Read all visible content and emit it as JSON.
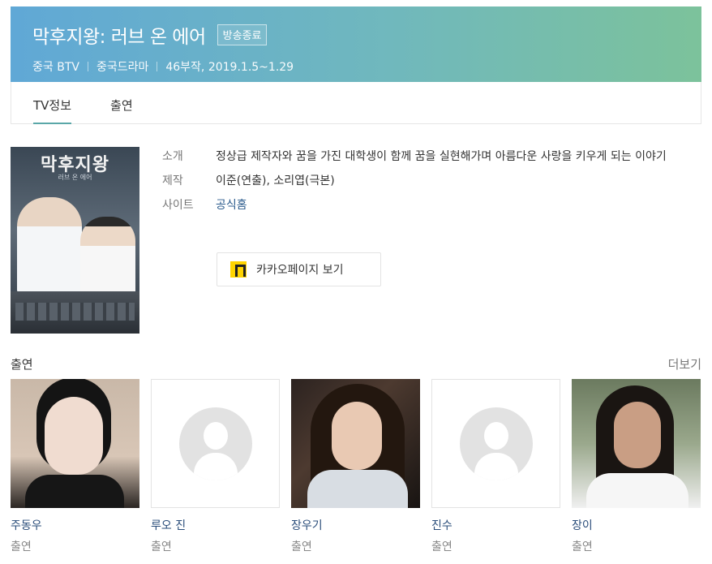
{
  "header": {
    "title": "막후지왕: 러브 온 에어",
    "status_badge": "방송종료",
    "meta": [
      "중국 BTV",
      "중국드라마",
      "46부작, 2019.1.5~1.29"
    ],
    "colors": {
      "gradient_start": "#60a8d6",
      "gradient_end": "#7cc29b"
    }
  },
  "tabs": [
    {
      "label": "TV정보",
      "active": true
    },
    {
      "label": "출연",
      "active": false
    }
  ],
  "poster": {
    "title": "막후지왕",
    "subtitle": "러브 온 에어"
  },
  "info": {
    "synopsis_label": "소개",
    "synopsis": "정상급 제작자와 꿈을 가진 대학생이 함께 꿈을 실현해가며 아름다운 사랑을 키우게 되는 이야기",
    "production_label": "제작",
    "production": "이준(연출), 소리엽(극본)",
    "site_label": "사이트",
    "site_link": "공식홈",
    "kakao_button": "카카오페이지 보기"
  },
  "cast_section": {
    "heading": "출연",
    "more": "더보기",
    "items": [
      {
        "name": "주동우",
        "role": "출연",
        "photo": "photo"
      },
      {
        "name": "루오 진",
        "role": "출연",
        "photo": "placeholder"
      },
      {
        "name": "장우기",
        "role": "출연",
        "photo": "photo"
      },
      {
        "name": "진수",
        "role": "출연",
        "photo": "placeholder"
      },
      {
        "name": "장이",
        "role": "출연",
        "photo": "photo"
      }
    ]
  }
}
